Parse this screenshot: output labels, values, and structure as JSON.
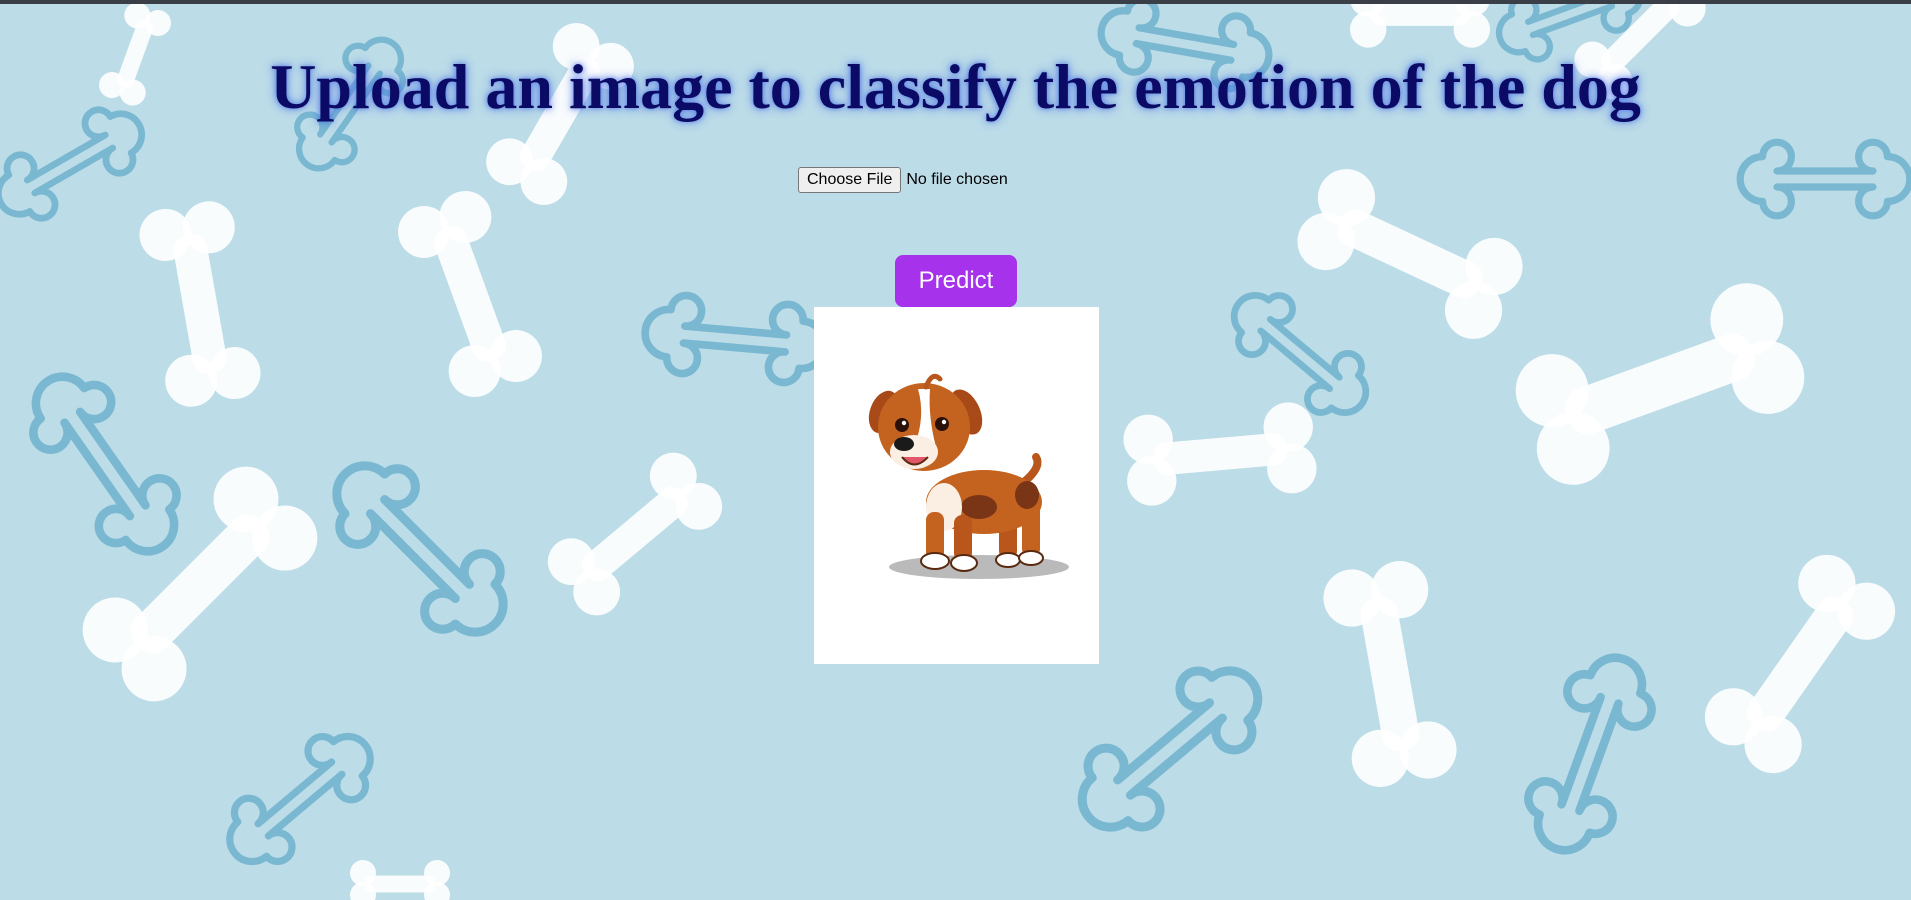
{
  "page": {
    "title": "Upload an image to classify the emotion of the dog"
  },
  "upload": {
    "button_label": "Choose File",
    "status_text": "No file chosen"
  },
  "predict": {
    "button_label": "Predict"
  },
  "preview": {
    "subject": "cartoon puppy"
  },
  "colors": {
    "background": "#bcdce8",
    "title": "#0b0b66",
    "predict_button": "#a632ec"
  },
  "icons": {
    "background_pattern": "bone-pattern"
  }
}
